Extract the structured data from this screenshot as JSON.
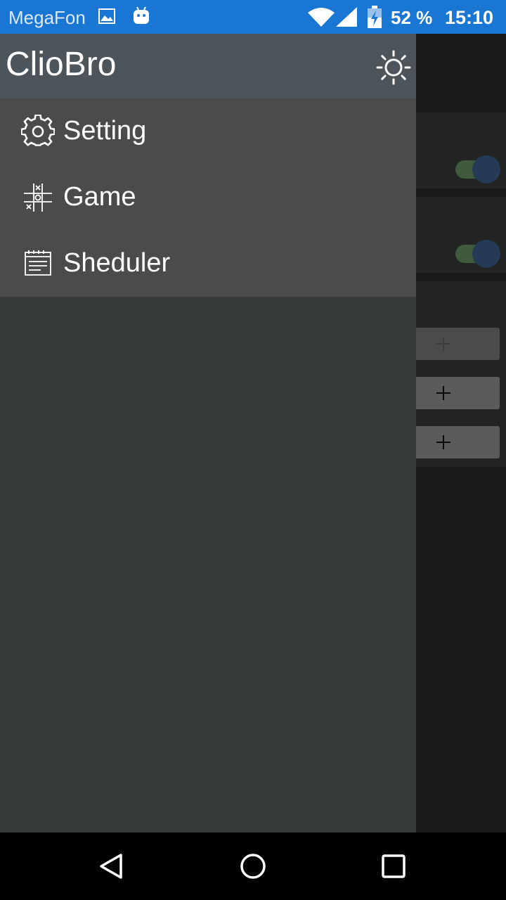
{
  "status_bar": {
    "carrier": "MegaFon",
    "battery_percent": "52 %",
    "time": "15:10",
    "icons": [
      "gallery-icon",
      "android-icon",
      "wifi-icon",
      "signal-icon",
      "battery-charging-icon"
    ]
  },
  "drawer": {
    "title": "ClioBro",
    "theme_icon": "sun-icon",
    "items": [
      {
        "label": "Setting",
        "icon": "gear-icon"
      },
      {
        "label": "Game",
        "icon": "tic-tac-toe-icon"
      },
      {
        "label": "Sheduler",
        "icon": "calendar-icon"
      }
    ]
  },
  "background_app": {
    "toggles": [
      {
        "on": true
      },
      {
        "on": true
      }
    ],
    "add_buttons": [
      "plus-icon",
      "plus-icon",
      "plus-icon"
    ]
  },
  "nav_bar": {
    "buttons": [
      "back-icon",
      "home-icon",
      "recents-icon"
    ]
  },
  "colors": {
    "status_bar": "#1976d2",
    "drawer_header": "#4d555b",
    "drawer_menu": "#4a4c4c",
    "drawer_body": "#363a3b",
    "nav_bar": "#000000"
  }
}
